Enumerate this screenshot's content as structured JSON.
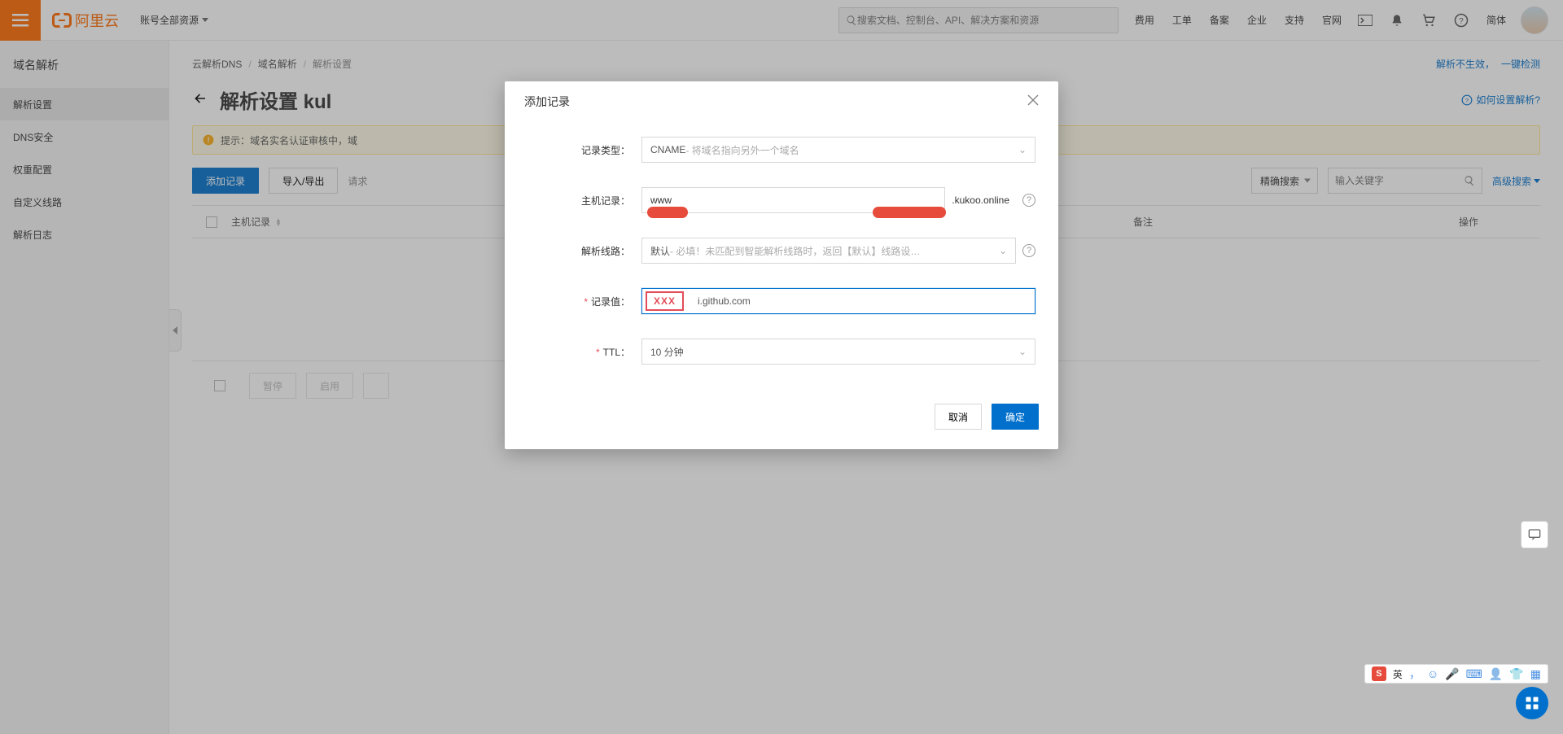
{
  "header": {
    "brand": "阿里云",
    "resource_dropdown": "账号全部资源",
    "search_placeholder": "搜索文档、控制台、API、解决方案和资源",
    "nav": [
      "费用",
      "工单",
      "备案",
      "企业",
      "支持",
      "官网"
    ],
    "lang": "简体"
  },
  "sidebar": {
    "title": "域名解析",
    "items": [
      "解析设置",
      "DNS安全",
      "权重配置",
      "自定义线路",
      "解析日志"
    ],
    "active_index": 0
  },
  "breadcrumb": {
    "items": [
      "云解析DNS",
      "域名解析",
      "解析设置"
    ],
    "right_link_a": "解析不生效，",
    "right_link_b": "一键检测"
  },
  "page": {
    "title_prefix": "解析设置",
    "domain_partial": "kul",
    "help_link": "如何设置解析?"
  },
  "notice": "提示：域名实名认证审核中，域",
  "toolbar": {
    "add": "添加记录",
    "io": "导入/导出",
    "req": "请求",
    "exact": "精确搜索",
    "keyword_placeholder": "输入关键字",
    "advanced": "高级搜索"
  },
  "table": {
    "col_host": "主机记录",
    "col_remark": "备注",
    "col_ops": "操作"
  },
  "footer_btns": {
    "pause": "暂停",
    "enable": "启用"
  },
  "modal": {
    "title": "添加记录",
    "labels": {
      "type": "记录类型：",
      "host": "主机记录：",
      "line": "解析线路：",
      "value": "记录值：",
      "ttl": "TTL："
    },
    "type_value": "CNAME",
    "type_desc": "- 将域名指向另外一个域名",
    "host_value": "www",
    "domain_suffix": ".kukoo.online",
    "line_value": "默认",
    "line_desc": " - 必填！未匹配到智能解析线路时，返回【默认】线路设…",
    "record_value_display": "i.github.com",
    "record_value_redact": "XXX",
    "ttl_value": "10 分钟",
    "cancel": "取消",
    "ok": "确定"
  },
  "ime": {
    "lang_label": "英"
  }
}
